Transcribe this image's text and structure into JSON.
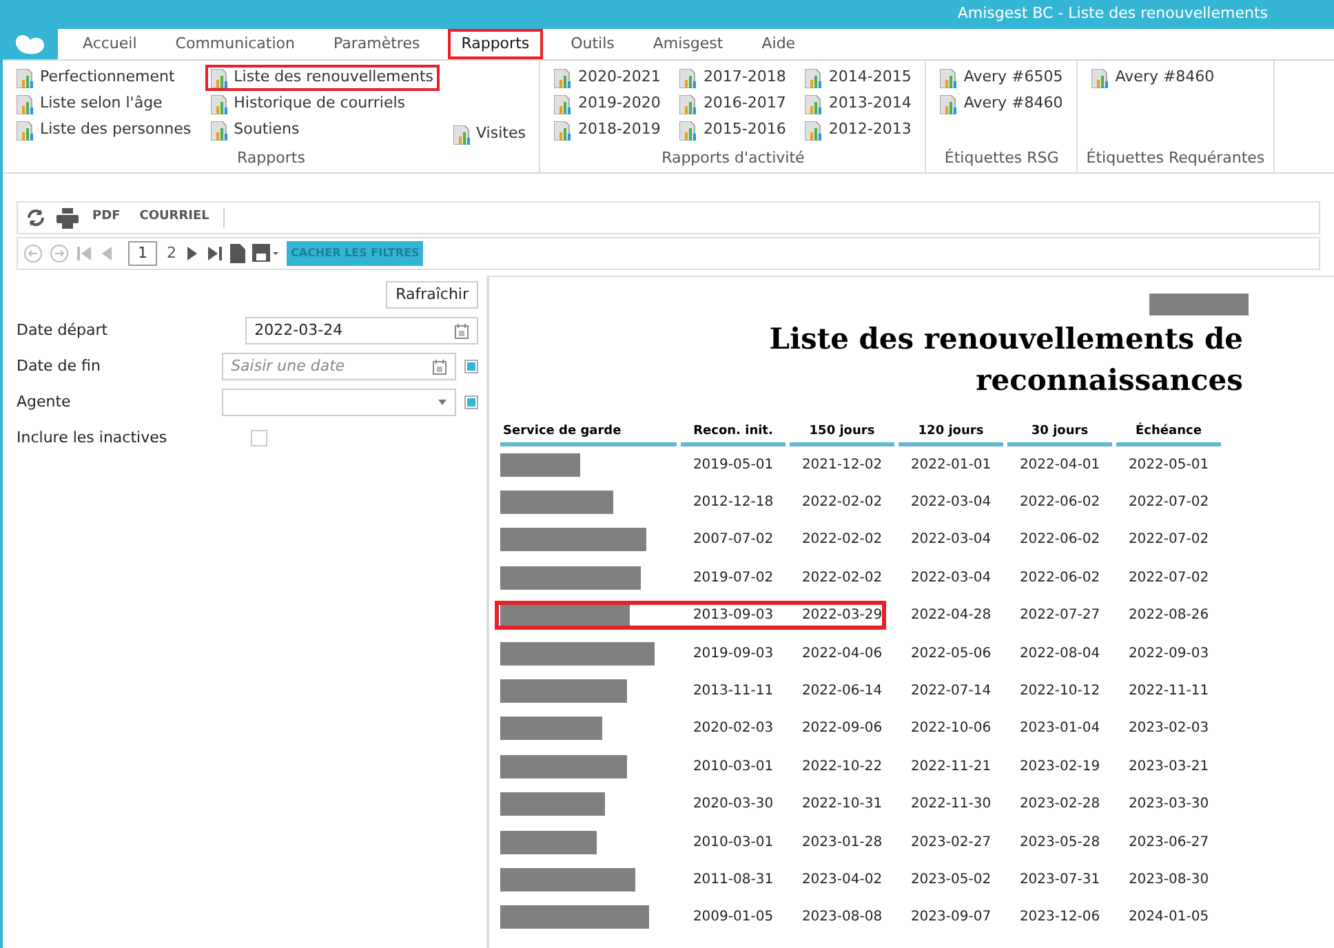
{
  "window": {
    "title": "Amisgest BC - Liste des renouvellements"
  },
  "menu": [
    {
      "label": "Accueil",
      "selected": false,
      "highlighted": false
    },
    {
      "label": "Communication",
      "selected": false,
      "highlighted": false
    },
    {
      "label": "Paramètres",
      "selected": false,
      "highlighted": false
    },
    {
      "label": "Rapports",
      "selected": true,
      "highlighted": true
    },
    {
      "label": "Outils",
      "selected": false,
      "highlighted": false
    },
    {
      "label": "Amisgest",
      "selected": false,
      "highlighted": false
    },
    {
      "label": "Aide",
      "selected": false,
      "highlighted": false
    }
  ],
  "ribbon": [
    {
      "title": "Rapports",
      "columns": [
        [
          {
            "label": "Perfectionnement",
            "highlighted": false
          },
          {
            "label": "Liste selon l'âge",
            "highlighted": false
          },
          {
            "label": "Liste des personnes",
            "highlighted": false
          }
        ],
        [
          {
            "label": "Liste des renouvellements",
            "highlighted": true
          },
          {
            "label": "Historique de courriels",
            "highlighted": false
          },
          {
            "label": "Soutiens",
            "highlighted": false
          }
        ],
        [
          {
            "label": "Visites",
            "highlighted": false
          }
        ]
      ]
    },
    {
      "title": "Rapports d'activité",
      "columns": [
        [
          {
            "label": "2020-2021",
            "highlighted": false
          },
          {
            "label": "2019-2020",
            "highlighted": false
          },
          {
            "label": "2018-2019",
            "highlighted": false
          }
        ],
        [
          {
            "label": "2017-2018",
            "highlighted": false
          },
          {
            "label": "2016-2017",
            "highlighted": false
          },
          {
            "label": "2015-2016",
            "highlighted": false
          }
        ],
        [
          {
            "label": "2014-2015",
            "highlighted": false
          },
          {
            "label": "2013-2014",
            "highlighted": false
          },
          {
            "label": "2012-2013",
            "highlighted": false
          }
        ]
      ]
    },
    {
      "title": "Étiquettes RSG",
      "columns": [
        [
          {
            "label": "Avery #6505",
            "highlighted": false
          },
          {
            "label": "Avery #8460",
            "highlighted": false
          }
        ]
      ]
    },
    {
      "title": "Étiquettes Requérantes",
      "columns": [
        [
          {
            "label": "Avery #8460",
            "highlighted": false
          }
        ]
      ]
    }
  ],
  "toolbar": {
    "pdf": "PDF",
    "email": "COURRIEL",
    "page": "1",
    "next_page": "2",
    "hide_filters": "CACHER LES FILTRES"
  },
  "filters": {
    "refresh": "Rafraîchir",
    "fields": [
      {
        "kind": "date",
        "label": "Date départ",
        "value": "2022-03-24"
      },
      {
        "kind": "date",
        "label": "Date de fin",
        "placeholder": "Saisir une date",
        "flag": true
      },
      {
        "kind": "select",
        "label": "Agente",
        "flag": true
      },
      {
        "kind": "checkbox",
        "label": "Inclure les inactives",
        "checked": false
      }
    ]
  },
  "report": {
    "title": "Liste des renouvellements de reconnaissances",
    "columns": [
      "Service de garde",
      "Recon. init.",
      "150 jours",
      "120 jours",
      "30 jours",
      "Échéance"
    ],
    "rows": [
      {
        "highlighted": false,
        "cells": [
          "",
          "2019-05-01",
          "2021-12-02",
          "2022-01-01",
          "2022-04-01",
          "2022-05-01"
        ]
      },
      {
        "highlighted": false,
        "cells": [
          "",
          "2012-12-18",
          "2022-02-02",
          "2022-03-04",
          "2022-06-02",
          "2022-07-02"
        ]
      },
      {
        "highlighted": false,
        "cells": [
          "",
          "2007-07-02",
          "2022-02-02",
          "2022-03-04",
          "2022-06-02",
          "2022-07-02"
        ]
      },
      {
        "highlighted": false,
        "cells": [
          "",
          "2019-07-02",
          "2022-02-02",
          "2022-03-04",
          "2022-06-02",
          "2022-07-02"
        ]
      },
      {
        "highlighted": true,
        "cells": [
          "",
          "2013-09-03",
          "2022-03-29",
          "2022-04-28",
          "2022-07-27",
          "2022-08-26"
        ]
      },
      {
        "highlighted": false,
        "cells": [
          "",
          "2019-09-03",
          "2022-04-06",
          "2022-05-06",
          "2022-08-04",
          "2022-09-03"
        ]
      },
      {
        "highlighted": false,
        "cells": [
          "",
          "2013-11-11",
          "2022-06-14",
          "2022-07-14",
          "2022-10-12",
          "2022-11-11"
        ]
      },
      {
        "highlighted": false,
        "cells": [
          "",
          "2020-02-03",
          "2022-09-06",
          "2022-10-06",
          "2023-01-04",
          "2023-02-03"
        ]
      },
      {
        "highlighted": false,
        "cells": [
          "",
          "2010-03-01",
          "2022-10-22",
          "2022-11-21",
          "2023-02-19",
          "2023-03-21"
        ]
      },
      {
        "highlighted": false,
        "cells": [
          "",
          "2020-03-30",
          "2022-10-31",
          "2022-11-30",
          "2023-02-28",
          "2023-03-30"
        ]
      },
      {
        "highlighted": false,
        "cells": [
          "",
          "2010-03-01",
          "2023-01-28",
          "2023-02-27",
          "2023-05-28",
          "2023-06-27"
        ]
      },
      {
        "highlighted": false,
        "cells": [
          "",
          "2011-08-31",
          "2023-04-02",
          "2023-05-02",
          "2023-07-31",
          "2023-08-30"
        ]
      },
      {
        "highlighted": false,
        "cells": [
          "",
          "2009-01-05",
          "2023-08-08",
          "2023-09-07",
          "2023-12-06",
          "2024-01-05"
        ]
      }
    ]
  }
}
